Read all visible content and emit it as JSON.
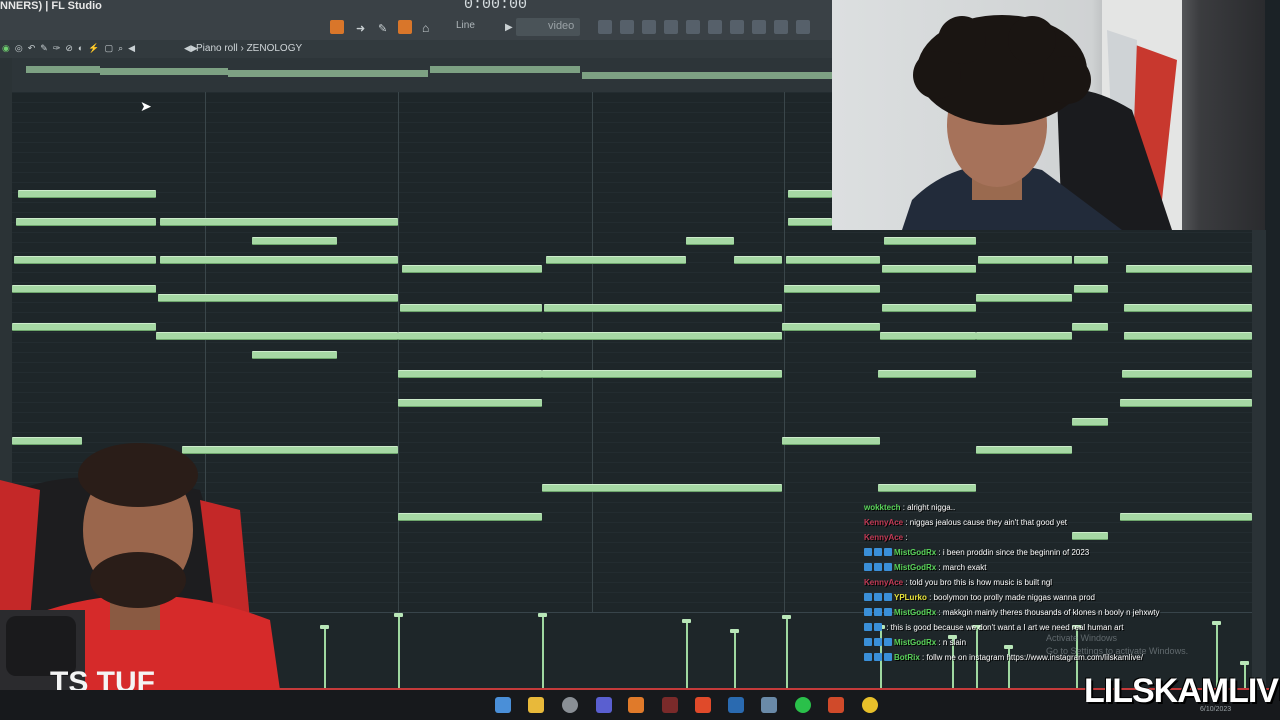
{
  "window": {
    "title": "NNERS) | FL Studio",
    "timecode": "0:00:00"
  },
  "toolbar": {
    "snap_label": "Line",
    "video_label": "video"
  },
  "piano_roll": {
    "title": "Piano roll › ZENOLOGY"
  },
  "chat": {
    "messages": [
      {
        "user": "wokktech",
        "text": ": alright nigga..",
        "user_color": "#5ad45a",
        "badges": 0
      },
      {
        "user": "KennyAce",
        "text": ": niggas jealous cause they ain't that good yet",
        "user_color": "#c23a55",
        "badges": 0
      },
      {
        "user": "KennyAce",
        "text": ":",
        "user_color": "#c23a55",
        "badges": 0
      },
      {
        "user": "MistGodRx",
        "text": ": i been proddin since the beginnin of 2023",
        "user_color": "#5ad45a",
        "badges": 3
      },
      {
        "user": "MistGodRx",
        "text": ": march exakt",
        "user_color": "#5ad45a",
        "badges": 3
      },
      {
        "user": "KennyAce",
        "text": ": told you bro this is how music is built ngl",
        "user_color": "#c23a55",
        "badges": 0
      },
      {
        "user": "YPLurko",
        "text": ": boolymon too prolly made niggas wanna prod",
        "user_color": "#e8e43a",
        "badges": 3
      },
      {
        "user": "MistGodRx",
        "text": ": makkgin mainly theres thousands of klones n booly n jehxwty",
        "user_color": "#5ad45a",
        "badges": 3
      },
      {
        "user": "",
        "text": ": this is good because we don't want a I art we need real human art",
        "user_color": "#c23a55",
        "badges": 2
      },
      {
        "user": "MistGodRx",
        "text": ": n slain",
        "user_color": "#5ad45a",
        "badges": 3
      },
      {
        "user": "BotRix",
        "text": ": follw me on instagram https://www.instagram.com/lilskamlive/",
        "user_color": "#5ad45a",
        "badges": 3
      }
    ]
  },
  "windows_notice": {
    "line1": "Activate Windows",
    "line2": "Go to Settings to activate Windows."
  },
  "watermark": "LILSKAMLIVE",
  "taskbar": {
    "date": "6/10/2023"
  },
  "colors": {
    "note": "#a6d8a4",
    "grid_bg": "#1e2629",
    "toolbar_bg": "#3a4146"
  }
}
